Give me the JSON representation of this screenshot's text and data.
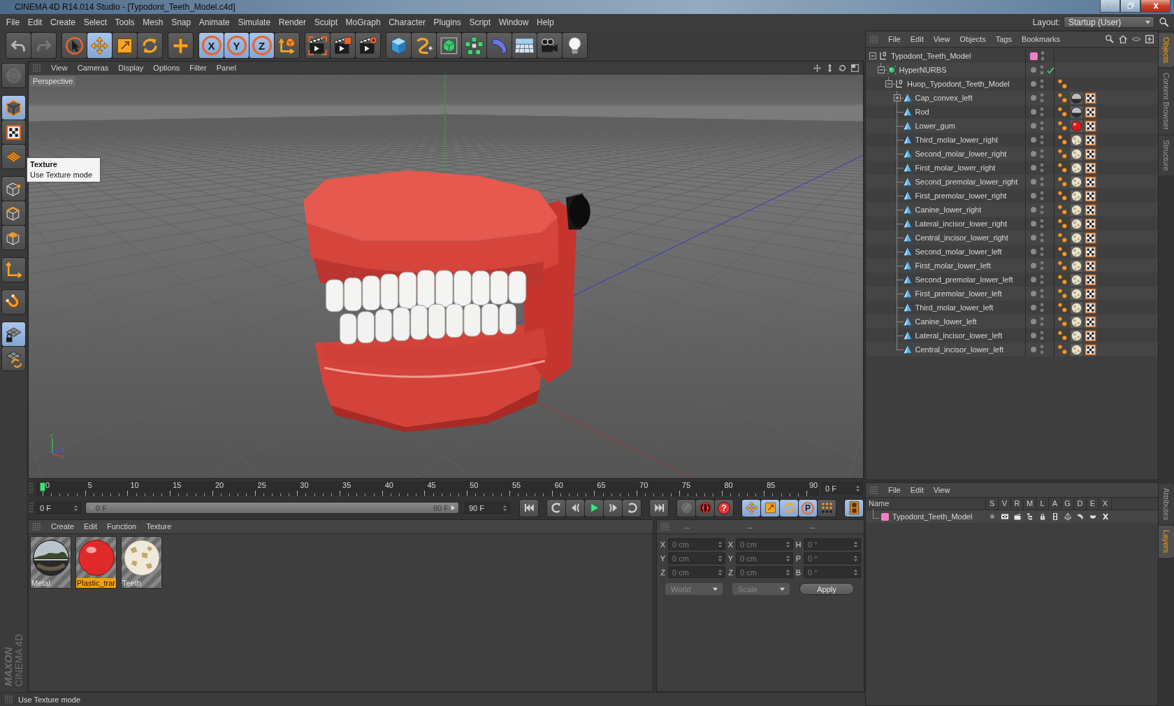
{
  "window": {
    "title": "CINEMA 4D R14.014 Studio - [Typodont_Teeth_Model.c4d]"
  },
  "menu_bar": {
    "items": [
      "File",
      "Edit",
      "Create",
      "Select",
      "Tools",
      "Mesh",
      "Snap",
      "Animate",
      "Simulate",
      "Render",
      "Sculpt",
      "MoGraph",
      "Character",
      "Plugins",
      "Script",
      "Window",
      "Help"
    ],
    "layout_label": "Layout:",
    "layout_value": "Startup (User)"
  },
  "toolbar": {
    "groups": [
      {
        "tools": [
          {
            "kind": "undo",
            "selected": false,
            "disabled": false
          },
          {
            "kind": "redo",
            "selected": false,
            "disabled": true
          }
        ]
      },
      {
        "tools": [
          {
            "kind": "live-select",
            "selected": false,
            "disabled": false
          },
          {
            "kind": "move",
            "selected": true,
            "disabled": false
          },
          {
            "kind": "scale",
            "selected": false,
            "disabled": false
          },
          {
            "kind": "rotate",
            "selected": false,
            "disabled": false
          }
        ]
      },
      {
        "tools": [
          {
            "kind": "plus",
            "selected": false,
            "disabled": false
          }
        ]
      },
      {
        "tools": [
          {
            "kind": "axis-lock",
            "label": "X",
            "selected": true,
            "disabled": false
          },
          {
            "kind": "axis-lock",
            "label": "Y",
            "selected": true,
            "disabled": false
          },
          {
            "kind": "axis-lock",
            "label": "Z",
            "selected": true,
            "disabled": false
          },
          {
            "kind": "world",
            "selected": false,
            "disabled": false
          }
        ]
      },
      {
        "tools": [
          {
            "kind": "render-view",
            "selected": false,
            "disabled": false
          },
          {
            "kind": "render-picture",
            "selected": false,
            "disabled": false
          },
          {
            "kind": "render-settings",
            "selected": false,
            "disabled": false
          }
        ]
      },
      {
        "tools": [
          {
            "kind": "cube",
            "selected": false,
            "disabled": false
          },
          {
            "kind": "spline",
            "selected": false,
            "disabled": false
          },
          {
            "kind": "nurbs",
            "selected": false,
            "disabled": false
          },
          {
            "kind": "array",
            "selected": false,
            "disabled": false
          },
          {
            "kind": "deformer",
            "selected": false,
            "disabled": false
          },
          {
            "kind": "floor",
            "selected": false,
            "disabled": false
          },
          {
            "kind": "camera",
            "selected": false,
            "disabled": false
          },
          {
            "kind": "light",
            "selected": false,
            "disabled": false
          }
        ]
      }
    ]
  },
  "mode_bar": {
    "groups": [
      {
        "tools": [
          {
            "kind": "make-editable",
            "selected": false,
            "disabled": true
          }
        ]
      },
      {
        "tools": [
          {
            "kind": "model",
            "selected": true,
            "disabled": false
          },
          {
            "kind": "texture",
            "selected": false,
            "disabled": false
          },
          {
            "kind": "workplane",
            "selected": false,
            "disabled": false
          }
        ]
      },
      {
        "tools": [
          {
            "kind": "points",
            "selected": false,
            "disabled": false
          },
          {
            "kind": "edges",
            "selected": false,
            "disabled": false
          },
          {
            "kind": "polygons",
            "selected": false,
            "disabled": false
          }
        ]
      },
      {
        "tools": [
          {
            "kind": "axis",
            "selected": false,
            "disabled": false
          }
        ]
      },
      {
        "tools": [
          {
            "kind": "snap",
            "selected": false,
            "disabled": false
          }
        ]
      },
      {
        "tools": [
          {
            "kind": "lock-workplane",
            "selected": true,
            "disabled": false
          },
          {
            "kind": "rotate-workplane",
            "selected": false,
            "disabled": false
          }
        ]
      }
    ]
  },
  "tooltip": {
    "title": "Texture",
    "text": "Use Texture mode"
  },
  "viewport": {
    "menu": [
      "View",
      "Cameras",
      "Display",
      "Options",
      "Filter",
      "Panel"
    ],
    "camera": "Perspective",
    "axis_labels": [
      "Y",
      "Z",
      "X"
    ]
  },
  "timeline": {
    "ticks": [
      "0",
      "5",
      "10",
      "15",
      "20",
      "25",
      "30",
      "35",
      "40",
      "45",
      "50",
      "55",
      "60",
      "65",
      "70",
      "75",
      "80",
      "85",
      "90"
    ],
    "level": 0,
    "current_frame": "0 F"
  },
  "transport": {
    "start_frame": "0 F",
    "range": {
      "start": "0 F",
      "end": "90 F",
      "level": 1
    },
    "end_frame": "90 F",
    "groups": [
      {
        "buttons": [
          {
            "kind": "go-start",
            "selected": false,
            "disabled": false
          }
        ]
      },
      {
        "buttons": [
          {
            "kind": "prev-key",
            "selected": false,
            "disabled": false
          },
          {
            "kind": "prev-frame",
            "selected": false,
            "disabled": false
          },
          {
            "kind": "play",
            "selected": false,
            "disabled": false
          },
          {
            "kind": "next-frame",
            "selected": false,
            "disabled": false
          },
          {
            "kind": "next-key",
            "selected": false,
            "disabled": false
          }
        ]
      },
      {
        "buttons": [
          {
            "kind": "go-end",
            "selected": false,
            "disabled": false
          }
        ]
      },
      {
        "buttons": [
          {
            "kind": "record",
            "selected": false,
            "disabled": true
          },
          {
            "kind": "autokey",
            "selected": false,
            "disabled": false
          },
          {
            "kind": "key-selection",
            "label": "?",
            "selected": false,
            "disabled": false
          }
        ]
      },
      {
        "buttons": [
          {
            "kind": "move-key",
            "selected": true,
            "disabled": false
          },
          {
            "kind": "scale-key",
            "selected": true,
            "disabled": false
          },
          {
            "kind": "rotate-key",
            "selected": true,
            "disabled": false
          },
          {
            "kind": "param-key",
            "label": "P",
            "selected": true,
            "disabled": false
          },
          {
            "kind": "pla-key",
            "selected": false,
            "disabled": false
          }
        ]
      },
      {
        "buttons": [
          {
            "kind": "timeline",
            "selected": true,
            "disabled": false
          }
        ]
      }
    ]
  },
  "materials": {
    "menu": [
      "Create",
      "Edit",
      "Function",
      "Texture"
    ],
    "items": [
      {
        "name": "Metal",
        "kind": "chrome",
        "selected": false
      },
      {
        "name": "Plastic_trar",
        "kind": "glossy",
        "selected": true
      },
      {
        "name": "Teeth",
        "kind": "marble",
        "selected": false
      }
    ]
  },
  "coordinates": {
    "disabled": true,
    "headers": [
      "--",
      "--",
      "--"
    ],
    "rows": [
      {
        "position_axis": "X",
        "position": "0 cm",
        "size_axis": "X",
        "size": "0 cm",
        "rotation_axis": "H",
        "rotation": "0 °"
      },
      {
        "position_axis": "Y",
        "position": "0 cm",
        "size_axis": "Y",
        "size": "0 cm",
        "rotation_axis": "P",
        "rotation": "0 °"
      },
      {
        "position_axis": "Z",
        "position": "0 cm",
        "size_axis": "Z",
        "size": "0 cm",
        "rotation_axis": "B",
        "rotation": "0 °"
      }
    ],
    "mode": "World",
    "size_mode": "Scale",
    "apply": "Apply"
  },
  "objects": {
    "menu": [
      "File",
      "Edit",
      "View",
      "Objects",
      "Tags",
      "Bookmarks"
    ],
    "tree": [
      {
        "name": "Typodont_Teeth_Model",
        "kind": "null",
        "color": "#f27fc6",
        "expanded": true,
        "children": [
          {
            "name": "HyperNURBS",
            "kind": "generator",
            "enabled": true,
            "expanded": true,
            "children": [
              {
                "name": "Huop_Typodont_Teeth_Model",
                "kind": "null",
                "expanded": true,
                "tags": [
                  {
                    "kind": "phong"
                  }
                ],
                "children": [
                  {
                    "name": "Cap_convex_left",
                    "kind": "polygon",
                    "expanded": false,
                    "tags": [
                      {
                        "kind": "phong"
                      },
                      {
                        "kind": "material-chrome"
                      },
                      {
                        "kind": "uvw"
                      }
                    ]
                  },
                  {
                    "name": "Rod",
                    "kind": "polygon",
                    "tags": [
                      {
                        "kind": "phong"
                      },
                      {
                        "kind": "material-chrome"
                      },
                      {
                        "kind": "uvw"
                      }
                    ]
                  },
                  {
                    "name": "Lower_gum",
                    "kind": "polygon",
                    "tags": [
                      {
                        "kind": "phong"
                      },
                      {
                        "kind": "material-glossy"
                      },
                      {
                        "kind": "uvw"
                      }
                    ]
                  },
                  {
                    "name": "Third_molar_lower_right",
                    "kind": "polygon",
                    "tags": [
                      {
                        "kind": "phong"
                      },
                      {
                        "kind": "material-marble"
                      },
                      {
                        "kind": "uvw"
                      }
                    ]
                  },
                  {
                    "name": "Second_molar_lower_right",
                    "kind": "polygon",
                    "tags": [
                      {
                        "kind": "phong"
                      },
                      {
                        "kind": "material-marble"
                      },
                      {
                        "kind": "uvw"
                      }
                    ]
                  },
                  {
                    "name": "First_molar_lower_right",
                    "kind": "polygon",
                    "tags": [
                      {
                        "kind": "phong"
                      },
                      {
                        "kind": "material-marble"
                      },
                      {
                        "kind": "uvw"
                      }
                    ]
                  },
                  {
                    "name": "Second_premolar_lower_right",
                    "kind": "polygon",
                    "tags": [
                      {
                        "kind": "phong"
                      },
                      {
                        "kind": "material-marble"
                      },
                      {
                        "kind": "uvw"
                      }
                    ]
                  },
                  {
                    "name": "First_premolar_lower_right",
                    "kind": "polygon",
                    "tags": [
                      {
                        "kind": "phong"
                      },
                      {
                        "kind": "material-marble"
                      },
                      {
                        "kind": "uvw"
                      }
                    ]
                  },
                  {
                    "name": "Canine_lower_right",
                    "kind": "polygon",
                    "tags": [
                      {
                        "kind": "phong"
                      },
                      {
                        "kind": "material-marble"
                      },
                      {
                        "kind": "uvw"
                      }
                    ]
                  },
                  {
                    "name": "Lateral_incisor_lower_right",
                    "kind": "polygon",
                    "tags": [
                      {
                        "kind": "phong"
                      },
                      {
                        "kind": "material-marble"
                      },
                      {
                        "kind": "uvw"
                      }
                    ]
                  },
                  {
                    "name": "Central_incisor_lower_right",
                    "kind": "polygon",
                    "tags": [
                      {
                        "kind": "phong"
                      },
                      {
                        "kind": "material-marble"
                      },
                      {
                        "kind": "uvw"
                      }
                    ]
                  },
                  {
                    "name": "Second_molar_lower_left",
                    "kind": "polygon",
                    "tags": [
                      {
                        "kind": "phong"
                      },
                      {
                        "kind": "material-marble"
                      },
                      {
                        "kind": "uvw"
                      }
                    ]
                  },
                  {
                    "name": "First_molar_lower_left",
                    "kind": "polygon",
                    "tags": [
                      {
                        "kind": "phong"
                      },
                      {
                        "kind": "material-marble"
                      },
                      {
                        "kind": "uvw"
                      }
                    ]
                  },
                  {
                    "name": "Second_premolar_lower_left",
                    "kind": "polygon",
                    "tags": [
                      {
                        "kind": "phong"
                      },
                      {
                        "kind": "material-marble"
                      },
                      {
                        "kind": "uvw"
                      }
                    ]
                  },
                  {
                    "name": "First_premolar_lower_left",
                    "kind": "polygon",
                    "tags": [
                      {
                        "kind": "phong"
                      },
                      {
                        "kind": "material-marble"
                      },
                      {
                        "kind": "uvw"
                      }
                    ]
                  },
                  {
                    "name": "Third_molar_lower_left",
                    "kind": "polygon",
                    "tags": [
                      {
                        "kind": "phong"
                      },
                      {
                        "kind": "material-marble"
                      },
                      {
                        "kind": "uvw"
                      }
                    ]
                  },
                  {
                    "name": "Canine_lower_left",
                    "kind": "polygon",
                    "tags": [
                      {
                        "kind": "phong"
                      },
                      {
                        "kind": "material-marble"
                      },
                      {
                        "kind": "uvw"
                      }
                    ]
                  },
                  {
                    "name": "Lateral_incisor_lower_left",
                    "kind": "polygon",
                    "tags": [
                      {
                        "kind": "phong"
                      },
                      {
                        "kind": "material-marble"
                      },
                      {
                        "kind": "uvw"
                      }
                    ]
                  },
                  {
                    "name": "Central_incisor_lower_left",
                    "kind": "polygon",
                    "tags": [
                      {
                        "kind": "phong"
                      },
                      {
                        "kind": "material-marble"
                      },
                      {
                        "kind": "uvw"
                      }
                    ]
                  }
                ]
              }
            ]
          }
        ]
      }
    ]
  },
  "side_tabs": {
    "top": [
      {
        "label": "Objects",
        "selected": true
      },
      {
        "label": "Content Browser",
        "selected": false
      },
      {
        "label": "Structure",
        "selected": false
      }
    ],
    "bottom": [
      {
        "label": "Attributes",
        "selected": false
      },
      {
        "label": "Layers",
        "selected": true
      }
    ]
  },
  "layers": {
    "menu": [
      "File",
      "Edit",
      "View"
    ],
    "name_header": "Name",
    "flag_headers": [
      "S",
      "V",
      "R",
      "M",
      "L",
      "A",
      "G",
      "D",
      "E",
      "X"
    ],
    "items": [
      {
        "name": "Typodont_Teeth_Model",
        "color": "#f27fc6"
      }
    ]
  },
  "status_bar": {
    "text": "Use Texture mode"
  },
  "logo": {
    "brand": "MAXON",
    "product": "CINEMA 4D"
  }
}
